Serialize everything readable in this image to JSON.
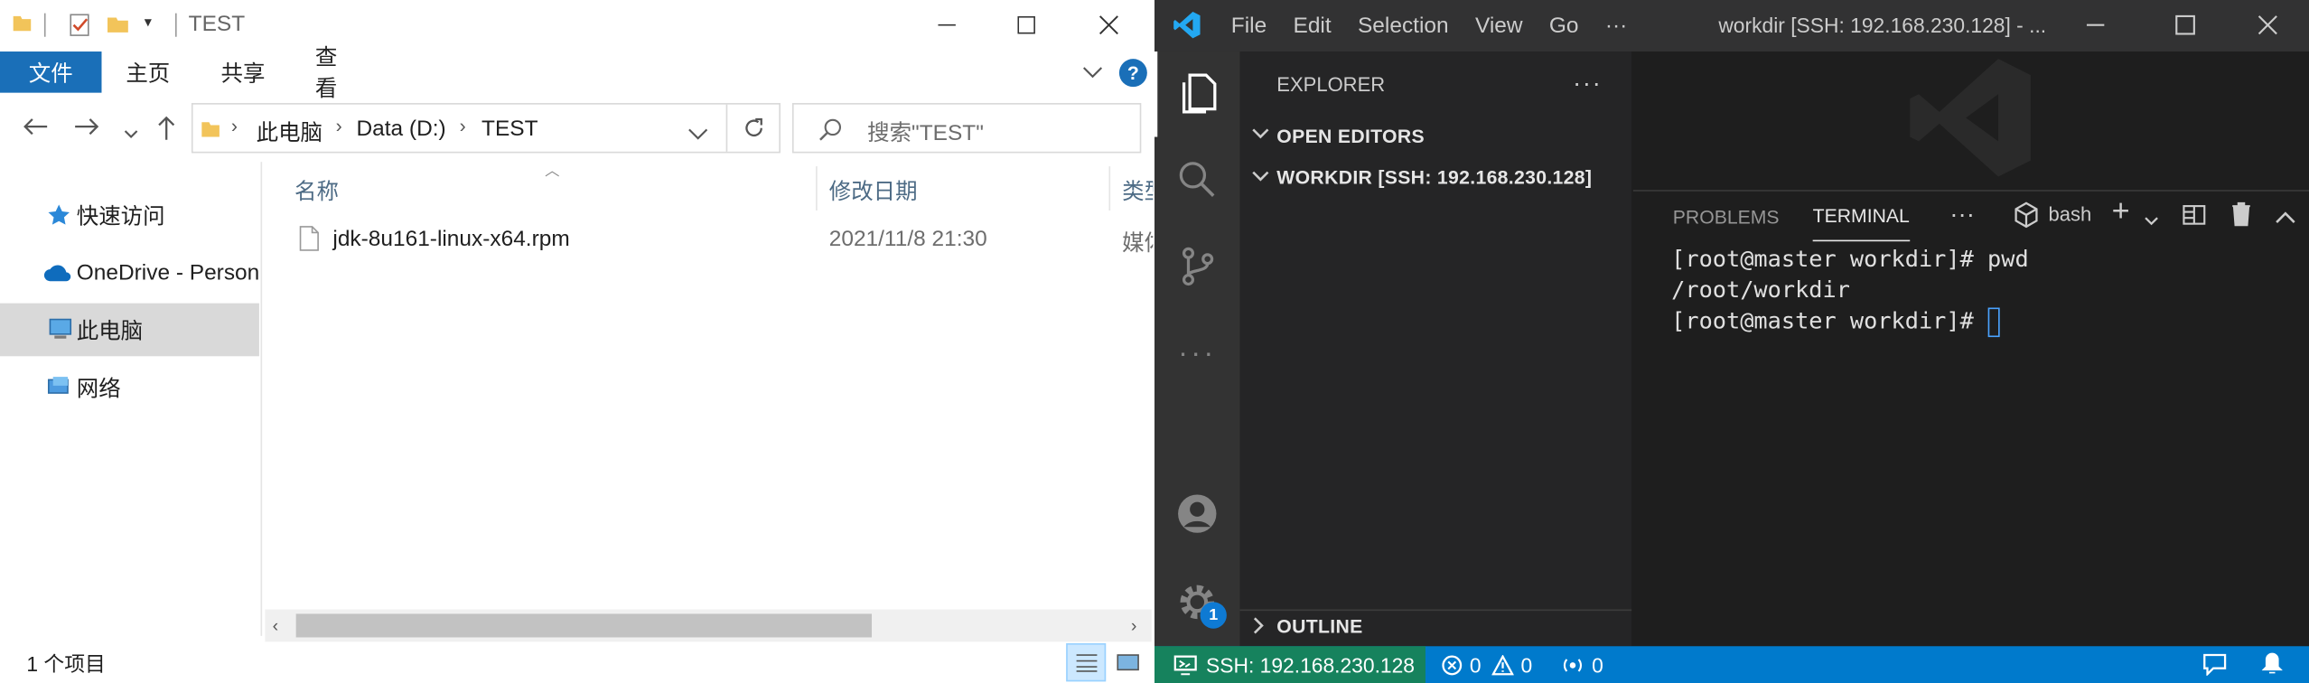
{
  "explorer": {
    "title": "TEST",
    "ribbon_tabs": [
      "文件",
      "主页",
      "共享",
      "查看"
    ],
    "breadcrumb": [
      "此电脑",
      "Data (D:)",
      "TEST"
    ],
    "search_placeholder": "搜索\"TEST\"",
    "nav": [
      "快速访问",
      "OneDrive - Personal",
      "此电脑",
      "网络"
    ],
    "columns": {
      "name": "名称",
      "date": "修改日期",
      "type": "类型"
    },
    "files": [
      {
        "name": "jdk-8u161-linux-x64.rpm",
        "date": "2021/11/8 21:30",
        "type": "媒体文件"
      }
    ],
    "status": "1 个项目",
    "help": "?"
  },
  "vscode": {
    "menu": [
      "File",
      "Edit",
      "Selection",
      "View",
      "Go",
      "···"
    ],
    "title": "workdir [SSH: 192.168.230.128] - ...",
    "sidebar_title": "EXPLORER",
    "sections": {
      "open_editors": "OPEN EDITORS",
      "workdir": "WORKDIR [SSH: 192.168.230.128]",
      "outline": "OUTLINE"
    },
    "panel_tabs": [
      "PROBLEMS",
      "TERMINAL"
    ],
    "shell": "bash",
    "terminal": [
      "[root@master workdir]# pwd",
      "/root/workdir",
      "[root@master workdir]# "
    ],
    "status": {
      "remote": "SSH: 192.168.230.128",
      "errors": "0",
      "warnings": "0",
      "ports": "0"
    },
    "settings_badge": "1",
    "colors": {
      "status_remote": "#16825d",
      "status_bar": "#007acc",
      "accent": "#0e7ad3"
    }
  }
}
